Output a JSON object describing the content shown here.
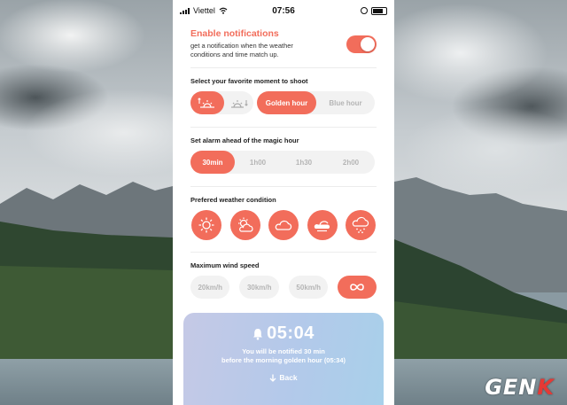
{
  "watermark": {
    "text_main": "GEN",
    "text_accent": "K"
  },
  "status_bar": {
    "carrier": "Viettel",
    "time": "07:56"
  },
  "notifications": {
    "title": "Enable notifications",
    "description": "get a notification when the weather conditions and time match up.",
    "toggle_on": true
  },
  "moment": {
    "label": "Select your favorite moment to shoot",
    "icons": [
      "sunrise-icon",
      "sunset-icon"
    ],
    "selected_icon": "sunrise-icon",
    "options": [
      "Golden hour",
      "Blue hour"
    ],
    "selected": "Golden hour"
  },
  "alarm": {
    "label": "Set alarm ahead of the magic hour",
    "options": [
      "30min",
      "1h00",
      "1h30",
      "2h00"
    ],
    "selected": "30min"
  },
  "weather": {
    "label": "Prefered weather condition",
    "options": [
      "sun-icon",
      "partly-cloudy-icon",
      "cloud-icon",
      "overcast-sun-icon",
      "snow-cloud-icon"
    ]
  },
  "wind": {
    "label": "Maximum wind speed",
    "options": [
      "20km/h",
      "30km/h",
      "50km/h"
    ],
    "selected": "infinity-icon"
  },
  "card": {
    "time": "05:04",
    "message_line1": "You will be notified 30 min",
    "message_line2": "before the morning golden hour (05:34)",
    "back_label": "Back"
  },
  "colors": {
    "accent": "#f26d5b",
    "inactive_bg": "#f2f2f2",
    "inactive_text": "#b5b5b5"
  }
}
